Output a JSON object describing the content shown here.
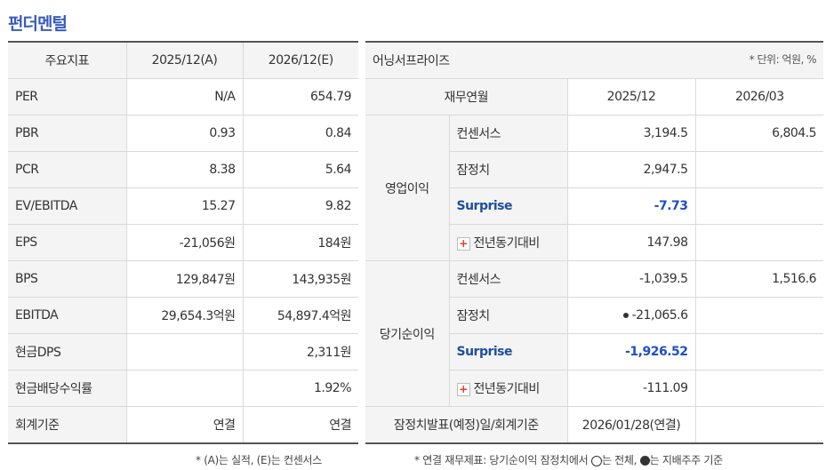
{
  "title": "펀더멘털",
  "left_table": {
    "headers": [
      "주요지표",
      "2025/12(A)",
      "2026/12(E)"
    ],
    "rows": [
      {
        "label": "PER",
        "a": "N/A",
        "e": "654.79"
      },
      {
        "label": "PBR",
        "a": "0.93",
        "e": "0.84"
      },
      {
        "label": "PCR",
        "a": "8.38",
        "e": "5.64"
      },
      {
        "label": "EV/EBITDA",
        "a": "15.27",
        "e": "9.82"
      },
      {
        "label": "EPS",
        "a": "-21,056원",
        "e": "184원"
      },
      {
        "label": "BPS",
        "a": "129,847원",
        "e": "143,935원"
      },
      {
        "label": "EBITDA",
        "a": "29,654.3억원",
        "e": "54,897.4억원"
      },
      {
        "label": "현금DPS",
        "a": "",
        "e": "2,311원"
      },
      {
        "label": "현금배당수익률",
        "a": "",
        "e": "1.92%"
      },
      {
        "label": "회계기준",
        "a": "연결",
        "e": "연결"
      }
    ],
    "note": "* (A)는 실적, (E)는 컨센서스"
  },
  "right_table": {
    "header": "어닝서프라이즈",
    "unit": "* 단위: 억원, %",
    "col_headers": [
      "재무연월",
      "2025/12",
      "2026/03"
    ],
    "groups": [
      {
        "name": "영업이익",
        "rows": [
          {
            "label": "컨센서스",
            "v1": "3,194.5",
            "v2": "6,804.5"
          },
          {
            "label": "잠정치",
            "v1": "2,947.5",
            "v2": ""
          },
          {
            "label": "Surprise",
            "v1": "-7.73",
            "v2": ""
          },
          {
            "label": "전년동기대비",
            "v1": "147.98",
            "v2": ""
          }
        ]
      },
      {
        "name": "당기순이익",
        "rows": [
          {
            "label": "컨센서스",
            "v1": "-1,039.5",
            "v2": "1,516.6"
          },
          {
            "label": "잠정치",
            "v1": "-21,065.6",
            "v2": ""
          },
          {
            "label": "Surprise",
            "v1": "-1,926.52",
            "v2": ""
          },
          {
            "label": "전년동기대비",
            "v1": "-111.09",
            "v2": ""
          }
        ]
      }
    ],
    "footer_label": "잠정치발표(예정)일/회계기준",
    "footer_value": "2026/01/28(연결)",
    "note_a": "* 연결 재무제표: 당기순이익 잠정치에서",
    "note_b": "는 전체,",
    "note_c": "는 지배주주 기준"
  }
}
